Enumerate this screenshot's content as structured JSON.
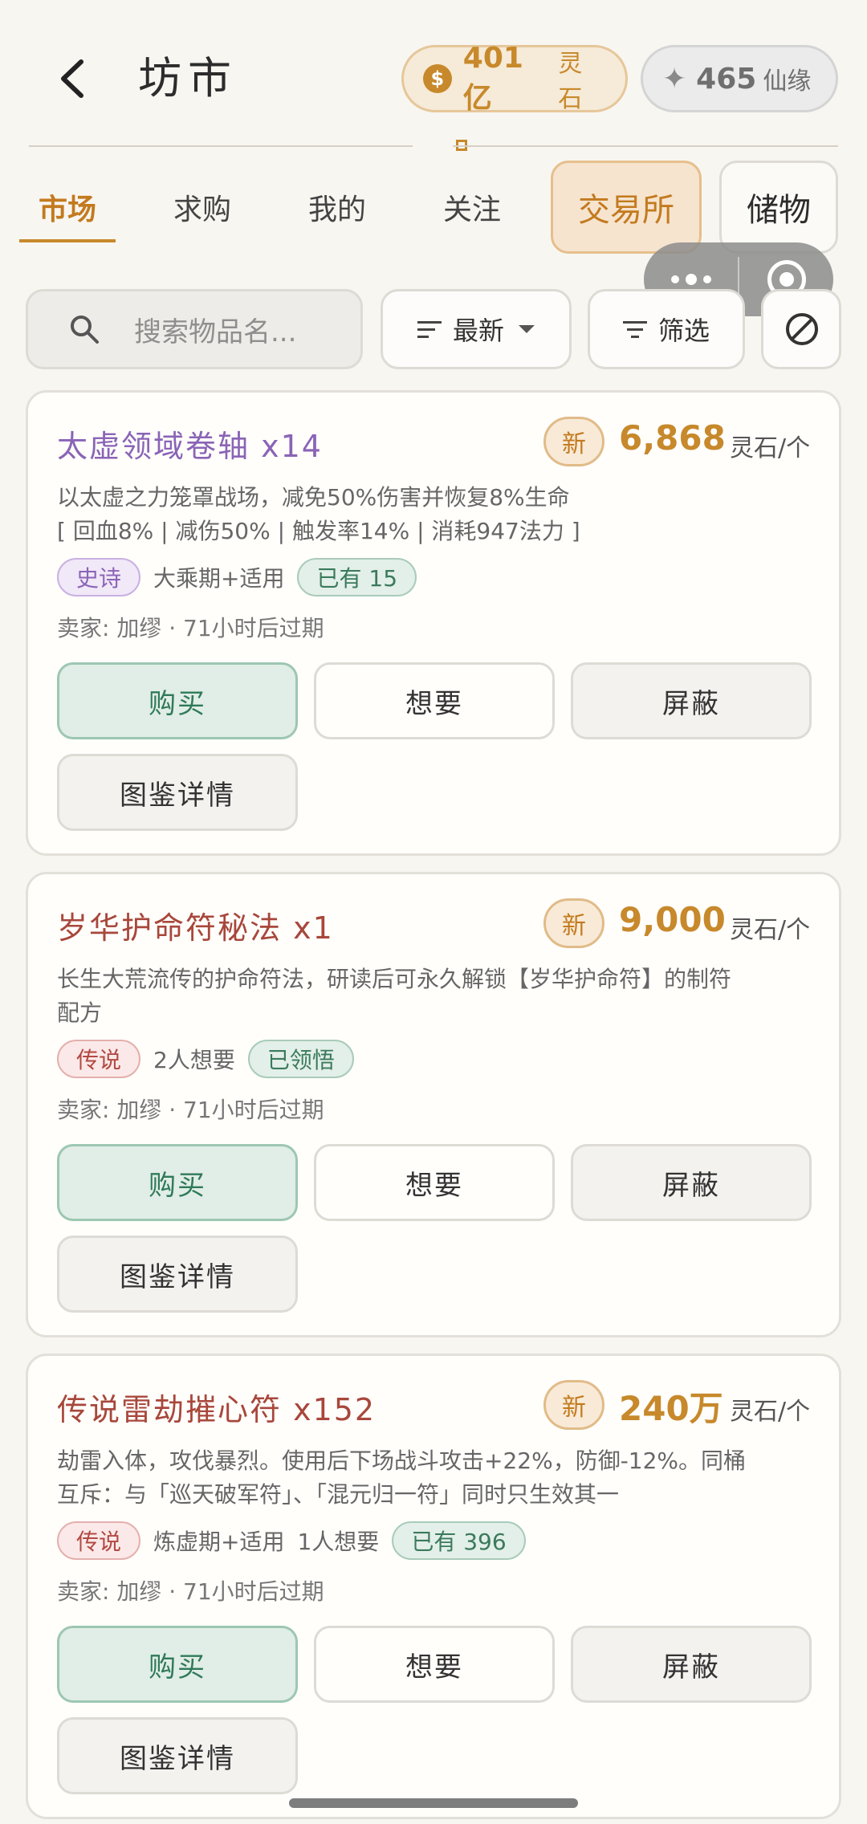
{
  "header": {
    "title": "坊市",
    "spirit_stone": {
      "amount": "401亿",
      "unit": "灵石"
    },
    "fate": {
      "amount": "465",
      "unit": "仙缘"
    }
  },
  "tabs": [
    {
      "label": "市场",
      "active": true
    },
    {
      "label": "求购"
    },
    {
      "label": "我的"
    },
    {
      "label": "关注"
    },
    {
      "label": "交易所"
    },
    {
      "label": "储物"
    }
  ],
  "search": {
    "placeholder": "搜索物品名..."
  },
  "filters": {
    "sort_label": "最新",
    "filter_label": "筛选"
  },
  "listings": [
    {
      "title": "太虚领域卷轴 x14",
      "new_badge": "新",
      "price": "6,868",
      "price_unit": "灵石/个",
      "desc_line1": "以太虚之力笼罩战场，减免50%伤害并恢复8%生命",
      "desc_line2": "[ 回血8% | 减伤50% | 触发率14% | 消耗947法力 ]",
      "rarity": "史诗",
      "info1": "大乘期+适用",
      "badge": "已有 15",
      "seller": "卖家: 加缪 · 71小时后过期"
    },
    {
      "title": "岁华护命符秘法 x1",
      "new_badge": "新",
      "price": "9,000",
      "price_unit": "灵石/个",
      "desc_line1": "长生大荒流传的护命符法，研读后可永久解锁【岁华护命符】的制符",
      "desc_line2": "配方",
      "rarity": "传说",
      "info1": "2人想要",
      "badge": "已领悟",
      "seller": "卖家: 加缪 · 71小时后过期"
    },
    {
      "title": "传说雷劫摧心符 x152",
      "new_badge": "新",
      "price": "240万",
      "price_unit": "灵石/个",
      "desc_line1": "劫雷入体，攻伐暴烈。使用后下场战斗攻击+22%，防御-12%。同桶",
      "desc_line2": "互斥：与「巡天破军符」、「混元归一符」同时只生效其一",
      "rarity": "传说",
      "info1": "炼虚期+适用",
      "info2": "1人想要",
      "badge": "已有 396",
      "seller": "卖家: 加缪 · 71小时后过期"
    }
  ],
  "actions": {
    "buy": "购买",
    "want": "想要",
    "block": "屏蔽",
    "details": "图鉴详情"
  },
  "colors": {
    "accent": "#c7892b",
    "epic": "#8a64b6",
    "legend": "#a8473b",
    "buy": "#2f7a58"
  }
}
